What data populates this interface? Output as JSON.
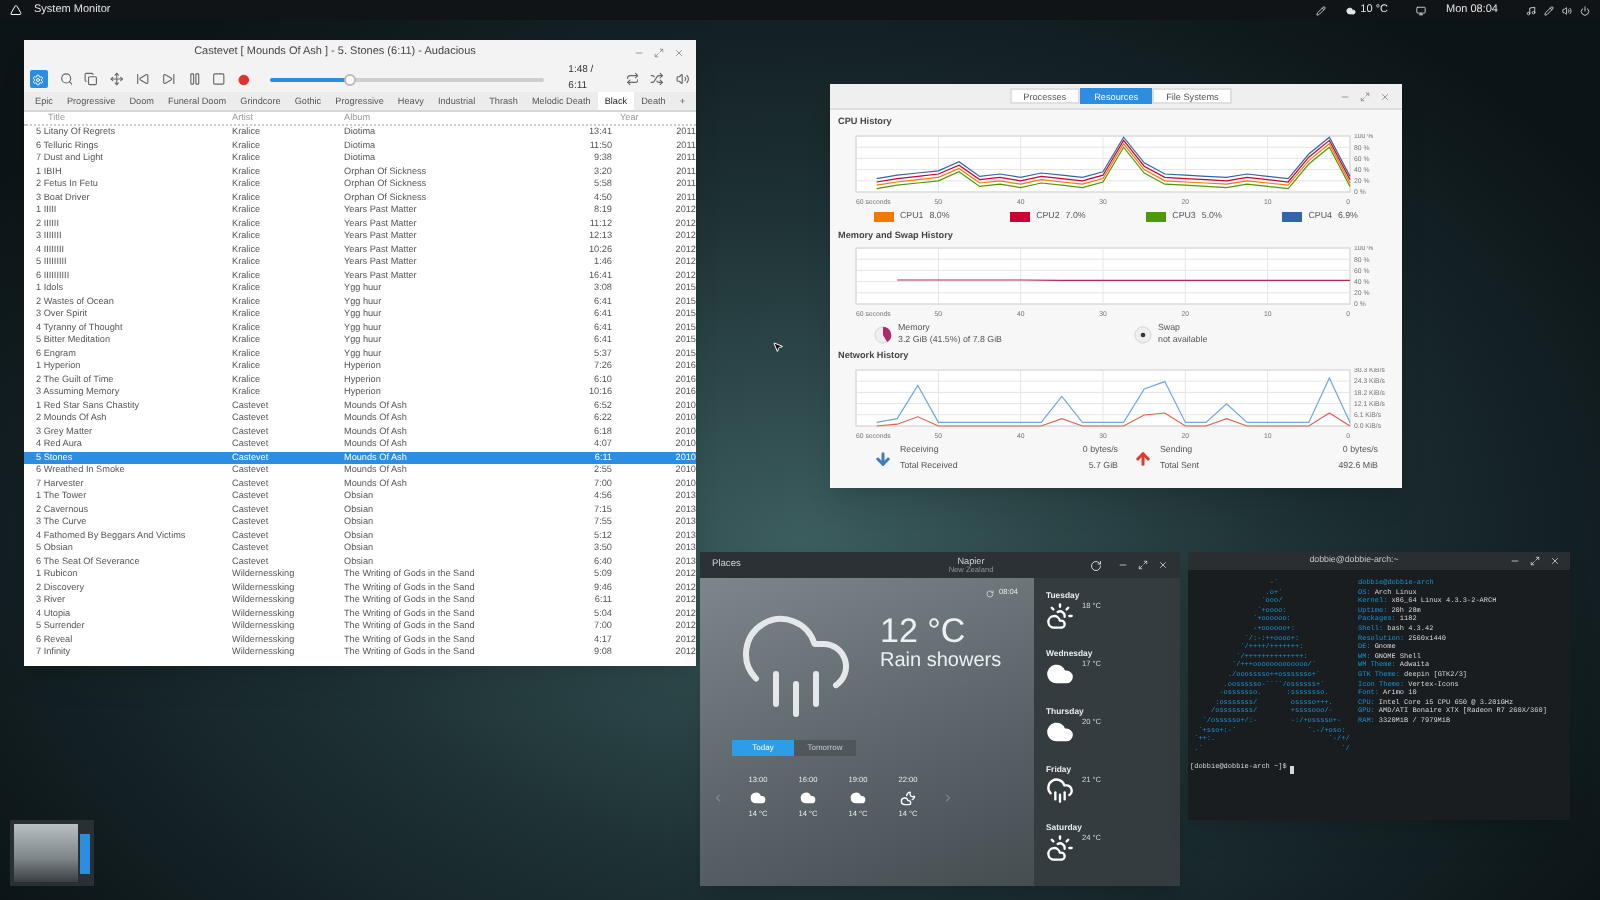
{
  "top_bar": {
    "app_menu": "System Monitor",
    "weather": "10 °C",
    "clock": "Mon 08:04"
  },
  "player": {
    "title": "Castevet [ Mounds Of Ash ] - 5. Stones (6:11) - Audacious",
    "time": "1:48 / 6:11",
    "level": 0.29,
    "tabs": [
      {
        "label": "Epic",
        "selected": false
      },
      {
        "label": "Progressive",
        "selected": false
      },
      {
        "label": "Doom",
        "selected": false
      },
      {
        "label": "Funeral Doom",
        "selected": false
      },
      {
        "label": "Grindcore",
        "selected": false
      },
      {
        "label": "Gothic",
        "selected": false
      },
      {
        "label": "Progressive",
        "selected": false
      },
      {
        "label": "Heavy",
        "selected": false
      },
      {
        "label": "Industrial",
        "selected": false
      },
      {
        "label": "Thrash",
        "selected": false
      },
      {
        "label": "Melodic Death",
        "selected": false
      },
      {
        "label": "Black",
        "selected": true
      },
      {
        "label": "Death",
        "selected": false
      },
      {
        "label": "+",
        "selected": false
      }
    ],
    "columns": [
      "Title",
      "Artist",
      "Album",
      "Year"
    ],
    "rows": [
      {
        "cells": [
          "5 Litany Of Regrets",
          "Kralice",
          "Diotima",
          "13:41",
          "2011"
        ],
        "selected": false
      },
      {
        "cells": [
          "6 Telluric Rings",
          "Kralice",
          "Diotima",
          "11:50",
          "2011"
        ],
        "selected": false
      },
      {
        "cells": [
          "7 Dust and Light",
          "Kralice",
          "Diotima",
          "9:38",
          "2011"
        ],
        "selected": false
      },
      {
        "cells": [
          "1 IBIH",
          "Kralice",
          "Orphan Of Sickness",
          "3:20",
          "2011"
        ],
        "selected": false
      },
      {
        "cells": [
          "2 Fetus In Fetu",
          "Kralice",
          "Orphan Of Sickness",
          "5:58",
          "2011"
        ],
        "selected": false
      },
      {
        "cells": [
          "3 Boat Driver",
          "Kralice",
          "Orphan Of Sickness",
          "4:50",
          "2011"
        ],
        "selected": false
      },
      {
        "cells": [
          "1 IIIII",
          "Kralice",
          "Years Past Matter",
          "8:19",
          "2012"
        ],
        "selected": false
      },
      {
        "cells": [
          "2 IIIIII",
          "Kralice",
          "Years Past Matter",
          "11:12",
          "2012"
        ],
        "selected": false
      },
      {
        "cells": [
          "3 IIIIIII",
          "Kralice",
          "Years Past Matter",
          "12:13",
          "2012"
        ],
        "selected": false
      },
      {
        "cells": [
          "4 IIIIIIII",
          "Kralice",
          "Years Past Matter",
          "10:26",
          "2012"
        ],
        "selected": false
      },
      {
        "cells": [
          "5 IIIIIIIII",
          "Kralice",
          "Years Past Matter",
          "1:46",
          "2012"
        ],
        "selected": false
      },
      {
        "cells": [
          "6 IIIIIIIIII",
          "Kralice",
          "Years Past Matter",
          "16:41",
          "2012"
        ],
        "selected": false
      },
      {
        "cells": [
          "1 Idols",
          "Kralice",
          "Ygg huur",
          "3:08",
          "2015"
        ],
        "selected": false
      },
      {
        "cells": [
          "2 Wastes of Ocean",
          "Kralice",
          "Ygg huur",
          "6:41",
          "2015"
        ],
        "selected": false
      },
      {
        "cells": [
          "3 Over Spirit",
          "Kralice",
          "Ygg huur",
          "6:41",
          "2015"
        ],
        "selected": false
      },
      {
        "cells": [
          "4 Tyranny of Thought",
          "Kralice",
          "Ygg huur",
          "6:41",
          "2015"
        ],
        "selected": false
      },
      {
        "cells": [
          "5 Bitter Meditation",
          "Kralice",
          "Ygg huur",
          "6:41",
          "2015"
        ],
        "selected": false
      },
      {
        "cells": [
          "6 Engram",
          "Kralice",
          "Ygg huur",
          "5:37",
          "2015"
        ],
        "selected": false
      },
      {
        "cells": [
          "1 Hyperion",
          "Kralice",
          "Hyperion",
          "7:26",
          "2016"
        ],
        "selected": false
      },
      {
        "cells": [
          "2 The Guilt of Time",
          "Kralice",
          "Hyperion",
          "6:10",
          "2016"
        ],
        "selected": false
      },
      {
        "cells": [
          "3 Assuming Memory",
          "Kralice",
          "Hyperion",
          "10:16",
          "2016"
        ],
        "selected": false
      },
      {
        "cells": [
          "1 Red Star Sans Chastity",
          "Castevet",
          "Mounds Of Ash",
          "6:52",
          "2010"
        ],
        "selected": false
      },
      {
        "cells": [
          "2 Mounds Of Ash",
          "Castevet",
          "Mounds Of Ash",
          "6:22",
          "2010"
        ],
        "selected": false
      },
      {
        "cells": [
          "3 Grey Matter",
          "Castevet",
          "Mounds Of Ash",
          "6:18",
          "2010"
        ],
        "selected": false
      },
      {
        "cells": [
          "4 Red Aura",
          "Castevet",
          "Mounds Of Ash",
          "4:07",
          "2010"
        ],
        "selected": false
      },
      {
        "cells": [
          "5 Stones",
          "Castevet",
          "Mounds Of Ash",
          "6:11",
          "2010"
        ],
        "selected": true
      },
      {
        "cells": [
          "6 Wreathed In Smoke",
          "Castevet",
          "Mounds Of Ash",
          "2:55",
          "2010"
        ],
        "selected": false
      },
      {
        "cells": [
          "7 Harvester",
          "Castevet",
          "Mounds Of Ash",
          "7:00",
          "2010"
        ],
        "selected": false
      },
      {
        "cells": [
          "1 The Tower",
          "Castevet",
          "Obsian",
          "4:56",
          "2013"
        ],
        "selected": false
      },
      {
        "cells": [
          "2 Cavernous",
          "Castevet",
          "Obsian",
          "7:15",
          "2013"
        ],
        "selected": false
      },
      {
        "cells": [
          "3 The Curve",
          "Castevet",
          "Obsian",
          "7:55",
          "2013"
        ],
        "selected": false
      },
      {
        "cells": [
          "4 Fathomed By Beggars And Victims",
          "Castevet",
          "Obsian",
          "5:12",
          "2013"
        ],
        "selected": false
      },
      {
        "cells": [
          "5 Obsian",
          "Castevet",
          "Obsian",
          "3:50",
          "2013"
        ],
        "selected": false
      },
      {
        "cells": [
          "6 The Seat Of Severance",
          "Castevet",
          "Obsian",
          "6:40",
          "2013"
        ],
        "selected": false
      },
      {
        "cells": [
          "1 Rubicon",
          "Wildernessking",
          "The Writing of Gods in the Sand",
          "5:09",
          "2012"
        ],
        "selected": false
      },
      {
        "cells": [
          "2 Discovery",
          "Wildernessking",
          "The Writing of Gods in the Sand",
          "9:46",
          "2012"
        ],
        "selected": false
      },
      {
        "cells": [
          "3 River",
          "Wildernessking",
          "The Writing of Gods in the Sand",
          "6:11",
          "2012"
        ],
        "selected": false
      },
      {
        "cells": [
          "4 Utopia",
          "Wildernessking",
          "The Writing of Gods in the Sand",
          "5:04",
          "2012"
        ],
        "selected": false
      },
      {
        "cells": [
          "5 Surrender",
          "Wildernessking",
          "The Writing of Gods in the Sand",
          "7:00",
          "2012"
        ],
        "selected": false
      },
      {
        "cells": [
          "6 Reveal",
          "Wildernessking",
          "The Writing of Gods in the Sand",
          "4:17",
          "2012"
        ],
        "selected": false
      },
      {
        "cells": [
          "7 Infinity",
          "Wildernessking",
          "The Writing of Gods in the Sand",
          "9:08",
          "2012"
        ],
        "selected": false
      }
    ]
  },
  "monitor": {
    "tabs": [
      {
        "label": "Processes",
        "selected": false
      },
      {
        "label": "Resources",
        "selected": true
      },
      {
        "label": "File Systems",
        "selected": false
      }
    ],
    "cpu": {
      "title": "CPU History",
      "chart_data": {
        "type": "line",
        "grid": true,
        "x": [
          57.5,
          55,
          52.5,
          50,
          47.5,
          45,
          42.5,
          40,
          37.5,
          35,
          32.5,
          30,
          27.5,
          25,
          22.5,
          20,
          17.5,
          15,
          12.5,
          10,
          7.5,
          5,
          2.5,
          0
        ],
        "xlim": [
          60,
          0
        ],
        "ylim": [
          0,
          100
        ],
        "xticks": [
          {
            "value": 60,
            "label": "60 seconds"
          },
          50,
          40,
          30,
          20,
          10,
          0
        ],
        "yticks": [
          {
            "value": 100,
            "label": "100 %"
          },
          {
            "value": 80,
            "label": "80 %"
          },
          {
            "value": 60,
            "label": "60 %"
          },
          {
            "value": 40,
            "label": "40 %"
          },
          {
            "value": 20,
            "label": "20 %"
          },
          {
            "value": 0,
            "label": "0 %"
          }
        ],
        "series": [
          {
            "name": "CPU1",
            "color": "#f57900",
            "values": [
              12,
              18,
              22,
              26,
              42,
              16,
              20,
              14,
              22,
              18,
              14,
              24,
              86,
              40,
              20,
              18,
              16,
              14,
              20,
              16,
              12,
              56,
              86,
              16
            ]
          },
          {
            "name": "CPU2",
            "color": "#cc0033",
            "values": [
              18,
              24,
              28,
              32,
              48,
              22,
              26,
              20,
              28,
              24,
              20,
              30,
              92,
              46,
              26,
              24,
              22,
              20,
              26,
              22,
              18,
              62,
              92,
              22
            ]
          },
          {
            "name": "CPU3",
            "color": "#4e9a06",
            "values": [
              6,
              12,
              16,
              20,
              36,
              10,
              14,
              8,
              16,
              12,
              8,
              18,
              80,
              34,
              14,
              12,
              10,
              8,
              14,
              10,
              6,
              50,
              80,
              10
            ]
          },
          {
            "name": "CPU4",
            "color": "#3465a4",
            "values": [
              24,
              30,
              34,
              38,
              54,
              28,
              32,
              26,
              34,
              30,
              26,
              36,
              98,
              52,
              32,
              30,
              28,
              26,
              32,
              28,
              24,
              68,
              98,
              28
            ]
          }
        ]
      },
      "legend": [
        {
          "reading": "8.0%"
        },
        {
          "reading": "7.0%"
        },
        {
          "reading": "5.0%"
        },
        {
          "reading": "6.9%"
        }
      ]
    },
    "memory": {
      "title": "Memory and Swap History",
      "chart_data": {
        "type": "line",
        "grid": true,
        "x": [
          55,
          50,
          45,
          40,
          35,
          30,
          25,
          20,
          15,
          10,
          5,
          0
        ],
        "xlim": [
          60,
          0
        ],
        "ylim": [
          0,
          100
        ],
        "xticks": [
          {
            "value": 60,
            "label": "60 seconds"
          },
          50,
          40,
          30,
          20,
          10,
          0
        ],
        "yticks": [
          {
            "value": 100,
            "label": "100 %"
          },
          {
            "value": 80,
            "label": "80 %"
          },
          {
            "value": 60,
            "label": "60 %"
          },
          {
            "value": 40,
            "label": "40 %"
          },
          {
            "value": 20,
            "label": "20 %"
          },
          {
            "value": 0,
            "label": "0 %"
          }
        ],
        "series": [
          {
            "name": "Memory",
            "color": "#ad2a64",
            "values": [
              43,
              43,
              43,
              43,
              42,
              42,
              42,
              42,
              42,
              42,
              42,
              42
            ]
          }
        ]
      },
      "items": [
        {
          "kind": "pie",
          "detail": "3.2 GiB (41.5%) of 7.8 GiB",
          "level": 0.415
        },
        {
          "kind": "empty",
          "label": "Swap",
          "detail": "not available"
        }
      ]
    },
    "network": {
      "title": "Network History",
      "chart_data": {
        "type": "line",
        "grid": true,
        "x": [
          57.5,
          55,
          52.5,
          50,
          47.5,
          45,
          42.5,
          40,
          37.5,
          35,
          32.5,
          30,
          27.5,
          25,
          22.5,
          20,
          17.5,
          15,
          12.5,
          10,
          7.5,
          5,
          2.5,
          0
        ],
        "xlim": [
          60,
          0
        ],
        "ylim": [
          0,
          30.3
        ],
        "xticks": [
          {
            "value": 60,
            "label": "60 seconds"
          },
          50,
          40,
          30,
          20,
          10,
          0
        ],
        "yticks": [
          {
            "value": 30.3,
            "label": "30.3 KiB/s"
          },
          {
            "value": 24.3,
            "label": "24.3 KiB/s"
          },
          {
            "value": 18.2,
            "label": "18.2 KiB/s"
          },
          {
            "value": 12.1,
            "label": "12.1 KiB/s"
          },
          {
            "value": 6.1,
            "label": "6.1 KiB/s"
          },
          {
            "value": 0,
            "label": "0.0 KiB/s"
          }
        ],
        "series": [
          {
            "name": "Receiving",
            "color": "#6fa8dc",
            "values": [
              2,
              4,
              22,
              2,
              2,
              2,
              2,
              2,
              2,
              16,
              2,
              2,
              2,
              20,
              24,
              2,
              2,
              12,
              2,
              2,
              2,
              2,
              26,
              2
            ]
          },
          {
            "name": "Sending",
            "color": "#e06050",
            "values": [
              0,
              1,
              5,
              0,
              0,
              0,
              0,
              0,
              0,
              4,
              0,
              0,
              0,
              6,
              7,
              0,
              0,
              4,
              0,
              0,
              0,
              0,
              7,
              0
            ]
          }
        ]
      },
      "items": [
        {
          "kind": "down",
          "rate": "0 bytes/s",
          "total_label": "Total Received",
          "total": "5.7 GiB"
        },
        {
          "kind": "up",
          "rate": "0 bytes/s",
          "total_label": "Total Sent",
          "total": "492.6 MiB"
        }
      ]
    }
  },
  "weather": {
    "places": "Places",
    "city": "Napier",
    "country": "New Zealand",
    "updated": "08:04",
    "temperature": "12 °C",
    "condition": "Rain showers",
    "tabs": [
      {
        "label": "Today",
        "selected": true
      },
      {
        "label": "Tomorrow",
        "selected": false
      }
    ],
    "hourly": [
      {
        "time": "13:00",
        "kind": "cloud",
        "temp": "14 °C"
      },
      {
        "time": "16:00",
        "kind": "cloud",
        "temp": "14 °C"
      },
      {
        "time": "19:00",
        "kind": "cloud",
        "temp": "14 °C"
      },
      {
        "time": "22:00",
        "kind": "night",
        "temp": "14 °C"
      }
    ],
    "forecast": [
      {
        "day": "Tuesday",
        "kind": "sun-cloud",
        "temp": "18 °C"
      },
      {
        "day": "Wednesday",
        "kind": "cloud",
        "temp": "17 °C"
      },
      {
        "day": "Thursday",
        "kind": "cloud",
        "temp": "20 °C"
      },
      {
        "day": "Friday",
        "kind": "rain",
        "temp": "21 °C"
      },
      {
        "day": "Saturday",
        "kind": "sun-cloud",
        "temp": "24 °C"
      }
    ]
  },
  "terminal": {
    "title": "dobbie@dobbie-arch:~",
    "art": [
      "                   -`",
      "                  .o+`",
      "                 `ooo/",
      "                `+oooo:",
      "               `+oooooo:",
      "               -+oooooo+:",
      "             `/:-:++oooo+:",
      "            `/++++/+++++++:",
      "           `/++++++++++++++:",
      "          `/+++ooooooooooooo/`",
      "         ./ooosssso++osssssso+`",
      "        .oossssso-````/ossssss+`",
      "       -osssssso.      :ssssssso.",
      "      :osssssss/        osssso+++.",
      "     /ossssssss/        +ssssooo/-",
      "   `/ossssso+/:-        -:/+osssso+-",
      "  `+sso+:-`                 `.-/+oso:",
      " `++:.                           `-/+/",
      " .`                                 `/"
    ],
    "user_host": "dobbie@dobbie-arch",
    "info": [
      {
        "key": "OS:",
        "value": "Arch Linux"
      },
      {
        "key": "Kernel:",
        "value": "x86_64 Linux 4.3.3-2-ARCH"
      },
      {
        "key": "Uptime:",
        "value": "20h 28m"
      },
      {
        "key": "Packages:",
        "value": "1182"
      },
      {
        "key": "Shell:",
        "value": "bash 4.3.42"
      },
      {
        "key": "Resolution:",
        "value": "2560x1440"
      },
      {
        "key": "DE:",
        "value": "Gnome"
      },
      {
        "key": "WM:",
        "value": "GNOME Shell"
      },
      {
        "key": "WM Theme:",
        "value": "Adwaita"
      },
      {
        "key": "GTK Theme:",
        "value": "deepin [GTK2/3]"
      },
      {
        "key": "Icon Theme:",
        "value": "Vertex-Icons"
      },
      {
        "key": "Font:",
        "value": "Arimo 10"
      },
      {
        "key": "CPU:",
        "value": "Intel Core i5 CPU 650 @ 3.201GHz"
      },
      {
        "key": "GPU:",
        "value": "AMD/ATI Bonaire XTX [Radeon R7 260X/360]"
      },
      {
        "key": "RAM:",
        "value": "3320MiB / 7979MiB"
      }
    ],
    "prompt": "[dobbie@dobbie-arch ~]$"
  }
}
